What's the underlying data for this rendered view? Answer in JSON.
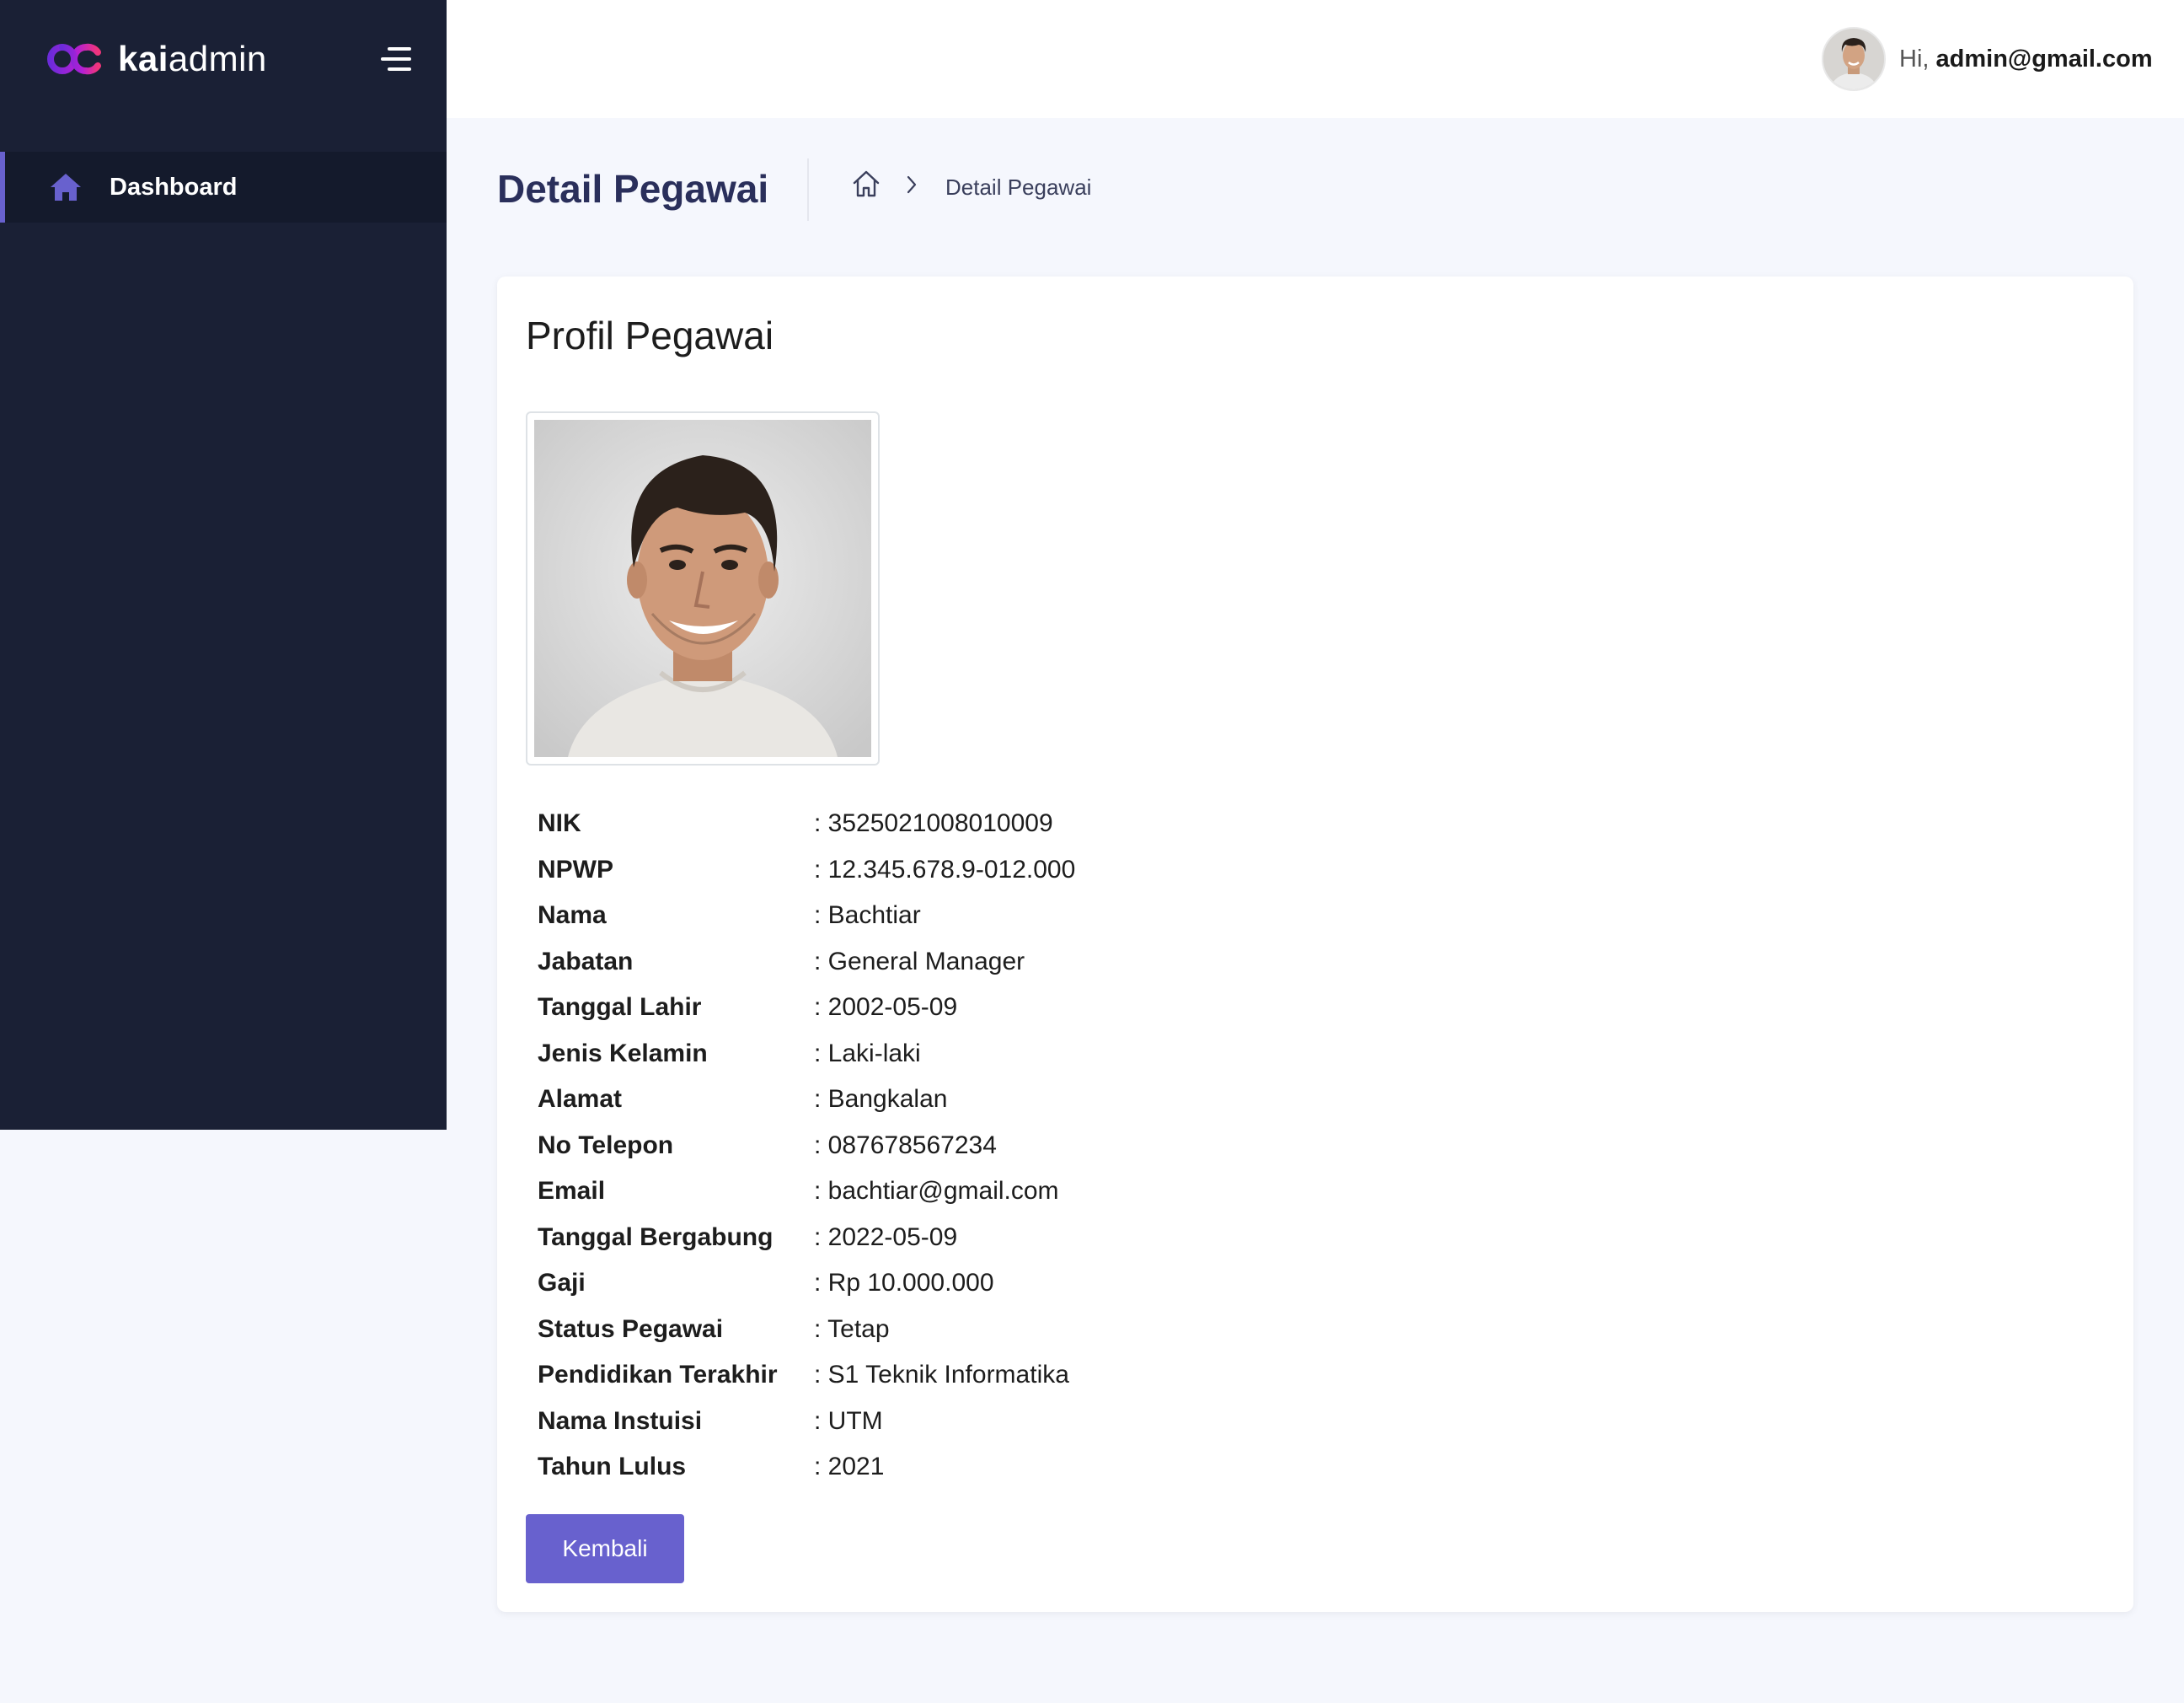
{
  "sidebar": {
    "logo": {
      "brand_bold": "kai",
      "brand_light": "admin"
    },
    "items": [
      {
        "label": "Dashboard",
        "icon": "home-icon"
      }
    ]
  },
  "topbar": {
    "greeting": "Hi,",
    "user_email": "admin@gmail.com"
  },
  "page": {
    "title": "Detail Pegawai",
    "breadcrumb": {
      "current": "Detail Pegawai"
    }
  },
  "card": {
    "title": "Profil Pegawai",
    "fields": [
      {
        "label": "NIK",
        "value": ": 3525021008010009"
      },
      {
        "label": "NPWP",
        "value": ": 12.345.678.9-012.000"
      },
      {
        "label": "Nama",
        "value": ": Bachtiar"
      },
      {
        "label": "Jabatan",
        "value": ": General Manager"
      },
      {
        "label": "Tanggal Lahir",
        "value": ": 2002-05-09"
      },
      {
        "label": "Jenis Kelamin",
        "value": ": Laki-laki"
      },
      {
        "label": "Alamat",
        "value": ": Bangkalan"
      },
      {
        "label": "No Telepon",
        "value": ": 087678567234"
      },
      {
        "label": "Email",
        "value": ": bachtiar@gmail.com"
      },
      {
        "label": "Tanggal Bergabung",
        "value": ": 2022-05-09"
      },
      {
        "label": "Gaji",
        "value": ": Rp 10.000.000"
      },
      {
        "label": "Status Pegawai",
        "value": ": Tetap"
      },
      {
        "label": "Pendidikan Terakhir",
        "value": ": S1 Teknik Informatika"
      },
      {
        "label": "Nama Instuisi",
        "value": ": UTM"
      },
      {
        "label": "Tahun Lulus",
        "value": ": 2021"
      }
    ],
    "back_button": "Kembali"
  },
  "colors": {
    "sidebar_bg": "#1a2035",
    "accent": "#6861ce",
    "page_bg": "#f5f7fd",
    "title_text": "#2a2f5b"
  }
}
